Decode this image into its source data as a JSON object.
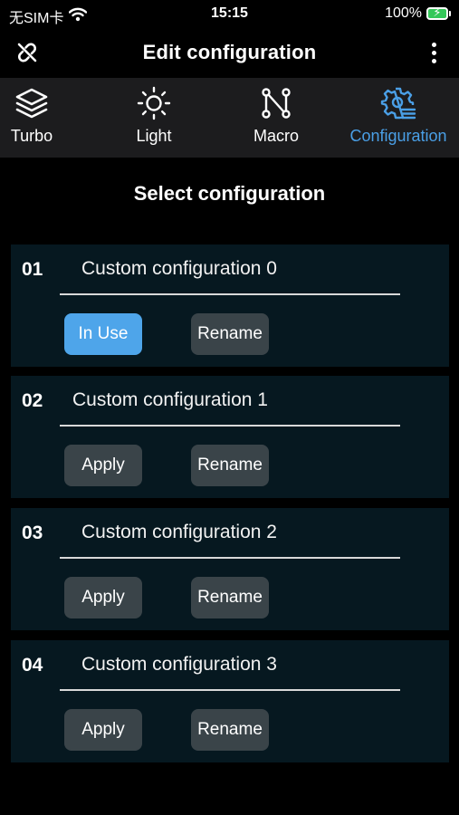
{
  "status_bar": {
    "carrier": "无SIM卡",
    "time": "15:15",
    "battery_percent": "100%",
    "battery_level": 1.0,
    "battery_color": "#34c759"
  },
  "header": {
    "title": "Edit configuration",
    "left_icon": "unlink-icon",
    "right_icon": "more-vertical-icon"
  },
  "tabs": [
    {
      "label": "Turbo",
      "icon": "layers-icon",
      "active": false
    },
    {
      "label": "Light",
      "icon": "sun-icon",
      "active": false
    },
    {
      "label": "Macro",
      "icon": "macro-nodes-icon",
      "active": false
    },
    {
      "label": "Configuration",
      "icon": "gear-list-icon",
      "active": true
    }
  ],
  "accent_color": "#4a9fe6",
  "section_title": "Select configuration",
  "configs": [
    {
      "number": "01",
      "name": "Custom configuration 0",
      "apply_label": "In Use",
      "rename_label": "Rename",
      "in_use": true
    },
    {
      "number": "02",
      "name": "Custom configuration 1",
      "apply_label": "Apply",
      "rename_label": "Rename",
      "in_use": false
    },
    {
      "number": "03",
      "name": "Custom configuration 2",
      "apply_label": "Apply",
      "rename_label": "Rename",
      "in_use": false
    },
    {
      "number": "04",
      "name": "Custom configuration 3",
      "apply_label": "Apply",
      "rename_label": "Rename",
      "in_use": false
    }
  ]
}
